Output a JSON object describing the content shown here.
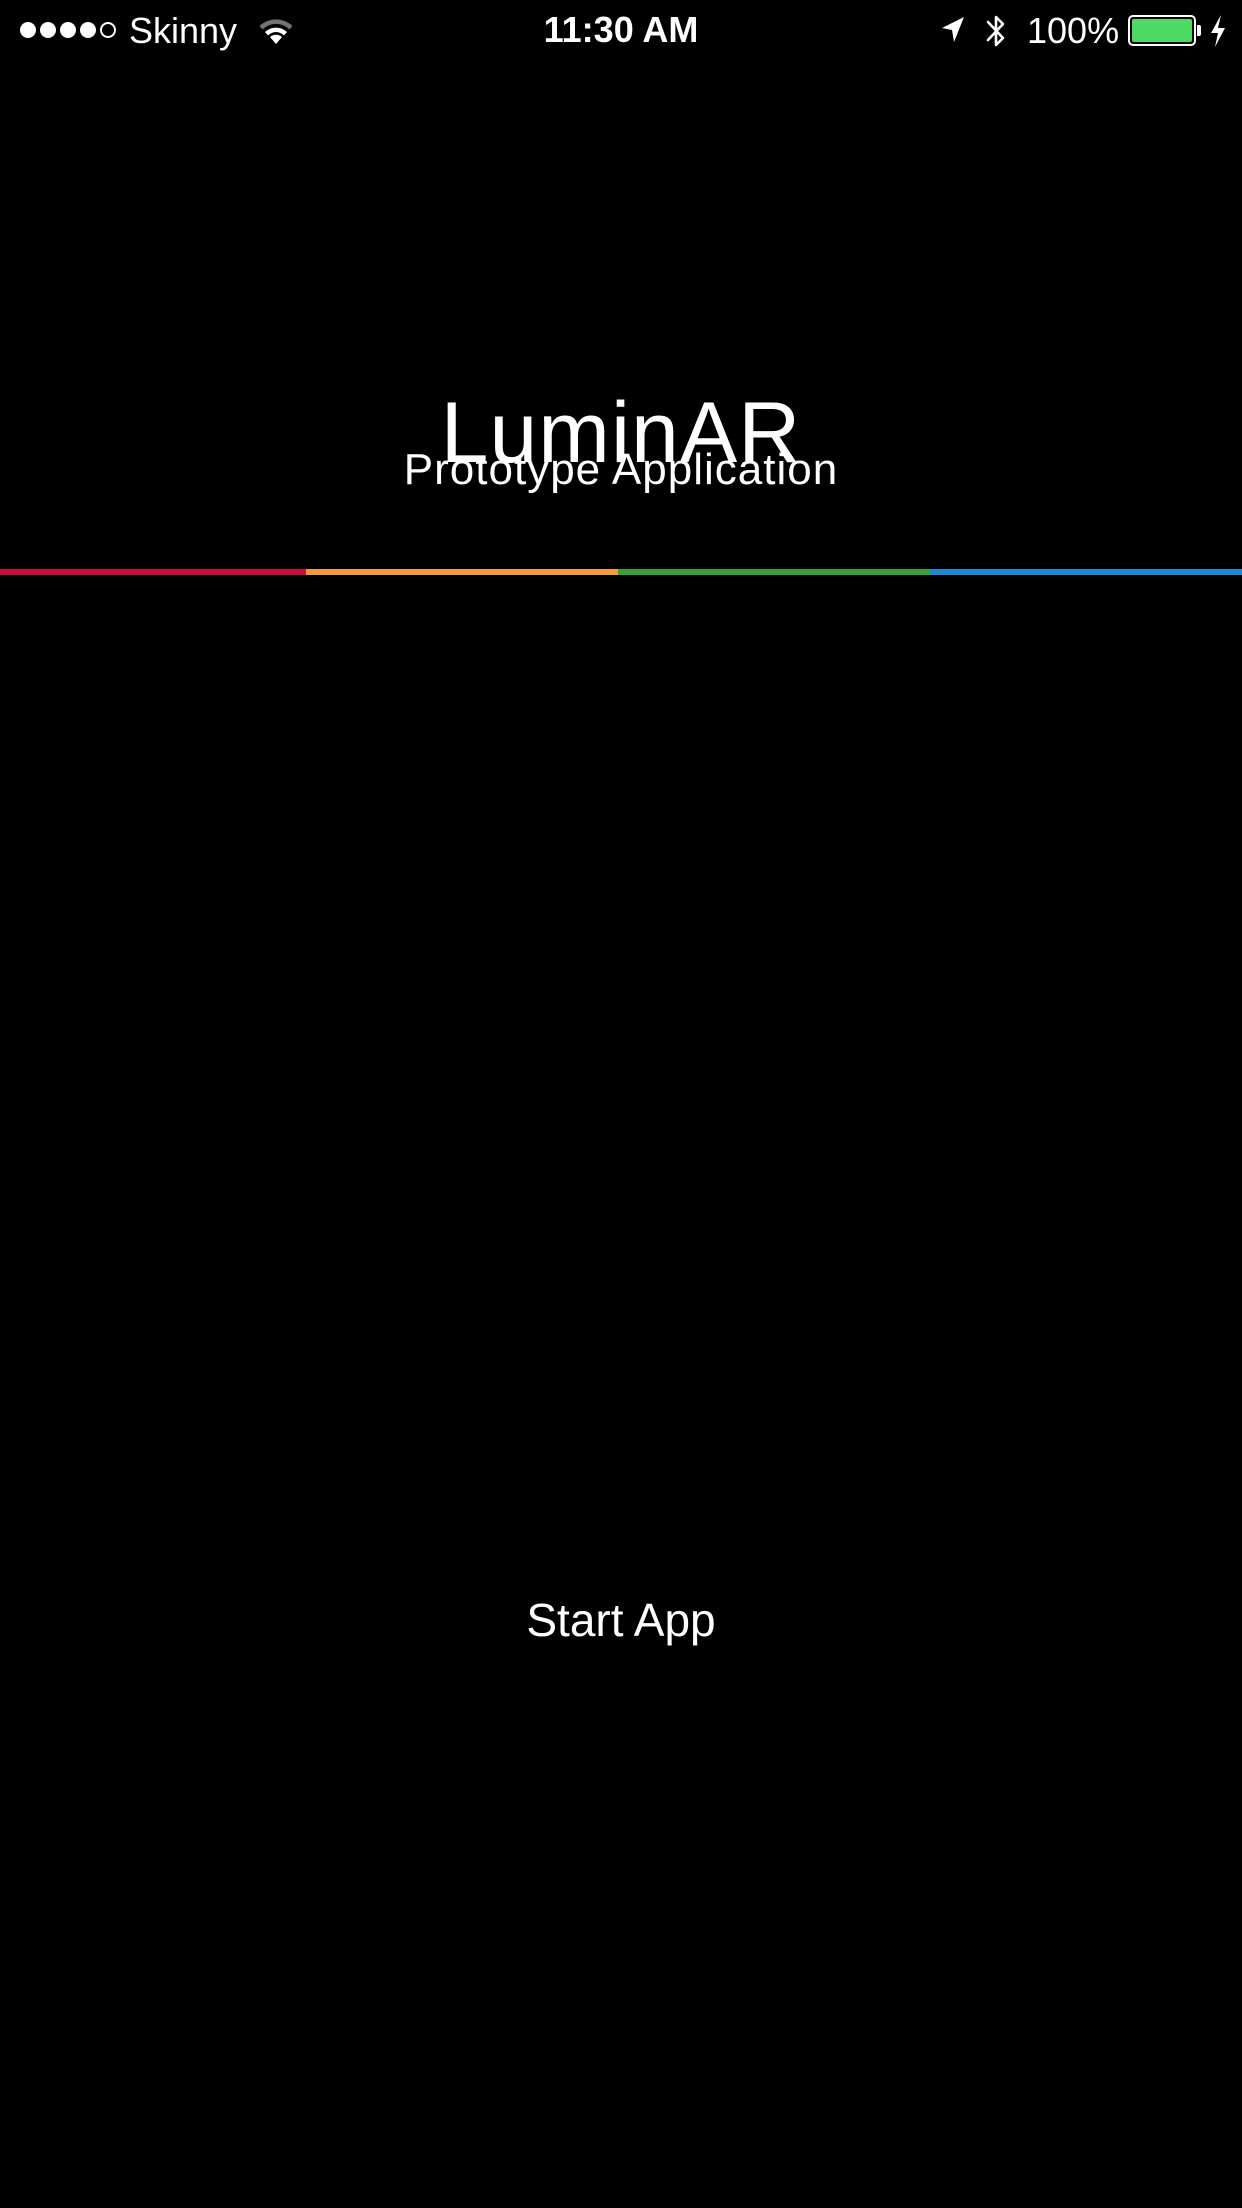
{
  "status_bar": {
    "signal_dots_filled": 4,
    "signal_dots_total": 5,
    "carrier": "Skinny",
    "wifi_icon": "wifi-icon",
    "time": "11:30 AM",
    "location_icon": "location-arrow-icon",
    "bluetooth_icon": "bluetooth-icon",
    "battery_percent": "100%",
    "battery_level": 1.0,
    "battery_color": "#4cd964",
    "charging_icon": "lightning-bolt-icon"
  },
  "app": {
    "title": "LuminAR",
    "subtitle": "Prototype Application"
  },
  "stripe": {
    "colors": [
      "#c8103e",
      "#f19a3e",
      "#3aa13a",
      "#1e88d8"
    ]
  },
  "actions": {
    "start_label": "Start App"
  }
}
